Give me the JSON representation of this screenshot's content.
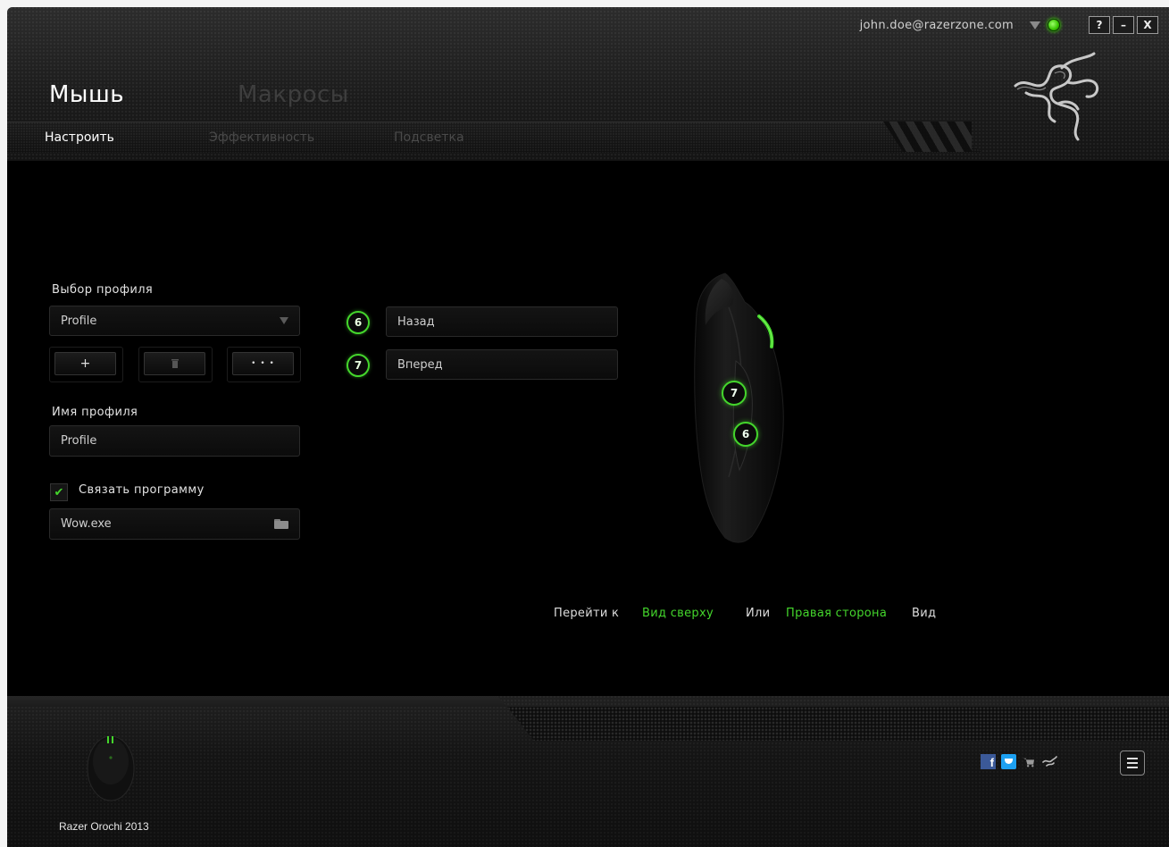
{
  "header": {
    "account_email": "john.doe@razerzone.com",
    "window_buttons": {
      "help": "?",
      "minimize": "–",
      "close": "X"
    },
    "main_tabs": [
      {
        "label": "Мышь",
        "active": true
      },
      {
        "label": "Макросы",
        "active": false
      }
    ],
    "sub_tabs": [
      {
        "label": "Настроить",
        "active": true
      },
      {
        "label": "Эффективность",
        "active": false
      },
      {
        "label": "Подсветка",
        "active": false
      }
    ]
  },
  "profile": {
    "select_label": "Выбор профиля",
    "selected_profile": "Profile",
    "add_button": "+",
    "more_button": "• • •",
    "name_label": "Имя профиля",
    "name_value": "Profile",
    "link_program_label": "Связать программу",
    "link_program_checked": true,
    "program_value": "Wow.exe"
  },
  "assignments": [
    {
      "number": "6",
      "function": "Назад"
    },
    {
      "number": "7",
      "function": "Вперед"
    }
  ],
  "view_switch": {
    "goto_text": "Перейти к",
    "top_view_link": "Вид сверху",
    "or_text": "Или",
    "right_side_link": "Правая сторона",
    "view_text": "Вид"
  },
  "mouse_buttons": [
    {
      "number": "7"
    },
    {
      "number": "6"
    }
  ],
  "footer": {
    "device_name": "Razer Orochi 2013",
    "social": {
      "facebook": "f"
    }
  },
  "colors": {
    "accent": "#44d62c",
    "background": "#000000",
    "inactive_tab": "#3e3e3e"
  },
  "icons": [
    "dropdown-arrow-icon",
    "status-online-icon",
    "razer-logo-icon",
    "trash-icon",
    "check-icon",
    "folder-icon",
    "facebook-icon",
    "twitter-icon",
    "cart-icon",
    "razer-icon",
    "menu-icon"
  ]
}
